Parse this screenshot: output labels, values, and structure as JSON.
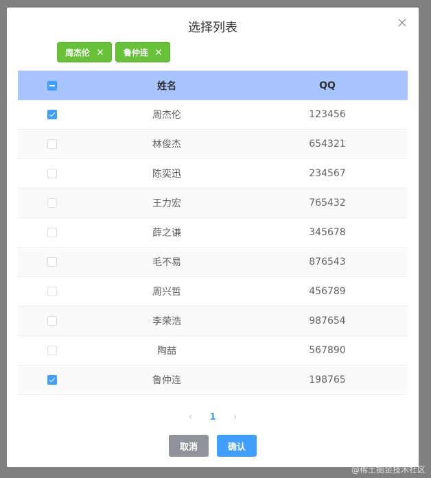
{
  "dialog": {
    "title": "选择列表",
    "tags": [
      {
        "label": "周杰伦"
      },
      {
        "label": "鲁仲连"
      }
    ]
  },
  "table": {
    "headers": {
      "name": "姓名",
      "qq": "QQ"
    },
    "header_checkbox_state": "indeterminate",
    "rows": [
      {
        "name": "周杰伦",
        "qq": "123456",
        "checked": true
      },
      {
        "name": "林俊杰",
        "qq": "654321",
        "checked": false
      },
      {
        "name": "陈奕迅",
        "qq": "234567",
        "checked": false
      },
      {
        "name": "王力宏",
        "qq": "765432",
        "checked": false
      },
      {
        "name": "薛之谦",
        "qq": "345678",
        "checked": false
      },
      {
        "name": "毛不易",
        "qq": "876543",
        "checked": false
      },
      {
        "name": "周兴哲",
        "qq": "456789",
        "checked": false
      },
      {
        "name": "李荣浩",
        "qq": "987654",
        "checked": false
      },
      {
        "name": "陶喆",
        "qq": "567890",
        "checked": false
      },
      {
        "name": "鲁仲连",
        "qq": "198765",
        "checked": true
      }
    ]
  },
  "pagination": {
    "prev": "‹",
    "current_page": "1",
    "next": "›"
  },
  "footer": {
    "cancel_label": "取消",
    "confirm_label": "确认"
  },
  "watermark": "@稀土掘金技术社区",
  "colors": {
    "overlay": "#808080",
    "header_bg": "#a8c4ff",
    "tag_bg": "#67c23a",
    "primary": "#409eff",
    "cancel": "#909399"
  }
}
